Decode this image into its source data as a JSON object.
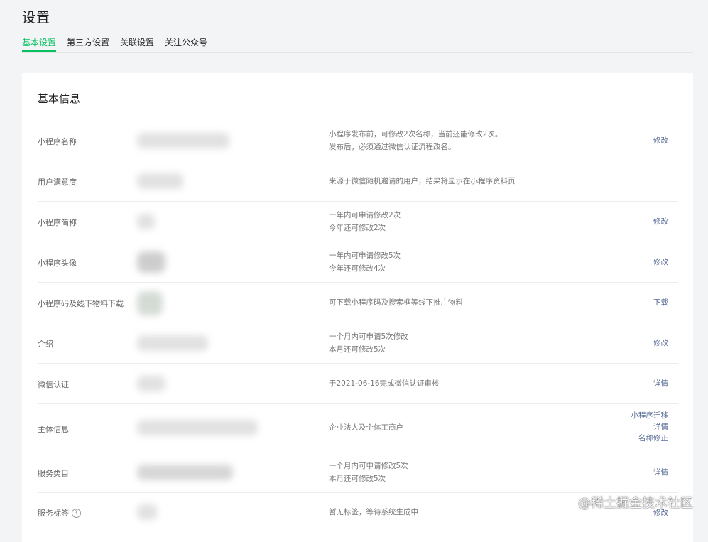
{
  "page": {
    "title": "设置"
  },
  "tabs": [
    {
      "label": "基本设置",
      "active": true
    },
    {
      "label": "第三方设置"
    },
    {
      "label": "关联设置"
    },
    {
      "label": "关注公众号"
    }
  ],
  "section": {
    "title": "基本信息"
  },
  "rows": [
    {
      "label": "小程序名称",
      "desc": [
        "小程序发布前，可修改2次名称，当前还能修改2次。",
        "发布后，必须通过微信认证流程改名。"
      ],
      "actions": [
        "修改"
      ]
    },
    {
      "label": "用户满意度",
      "desc": [
        "来源于微信随机邀请的用户，结果将显示在小程序资料页"
      ],
      "actions": []
    },
    {
      "label": "小程序简称",
      "desc": [
        "一年内可申请修改2次",
        "今年还可修改2次"
      ],
      "actions": [
        "修改"
      ]
    },
    {
      "label": "小程序头像",
      "desc": [
        "一年内可申请修改5次",
        "今年还可修改4次"
      ],
      "actions": [
        "修改"
      ]
    },
    {
      "label": "小程序码及线下物料下载",
      "desc": [
        "可下载小程序码及搜索框等线下推广物料"
      ],
      "actions": [
        "下载"
      ]
    },
    {
      "label": "介绍",
      "desc": [
        "一个月内可申请5次修改",
        "本月还可修改5次"
      ],
      "actions": [
        "修改"
      ]
    },
    {
      "label": "微信认证",
      "desc": [
        "于2021-06-16完成微信认证审核"
      ],
      "actions": [
        "详情"
      ]
    },
    {
      "label": "主体信息",
      "desc": [
        "企业法人及个体工商户"
      ],
      "actions": [
        "小程序迁移",
        "详情",
        "名称修正"
      ]
    },
    {
      "label": "服务类目",
      "desc": [
        "一个月内可申请修改5次",
        "本月还可修改5次"
      ],
      "actions": [
        "详情"
      ]
    },
    {
      "label": "服务标签",
      "help": "?",
      "desc": [
        "暂无标签，等待系统生成中"
      ],
      "actions": [
        "修改"
      ]
    }
  ],
  "watermark": "@稀土掘金技术社区"
}
